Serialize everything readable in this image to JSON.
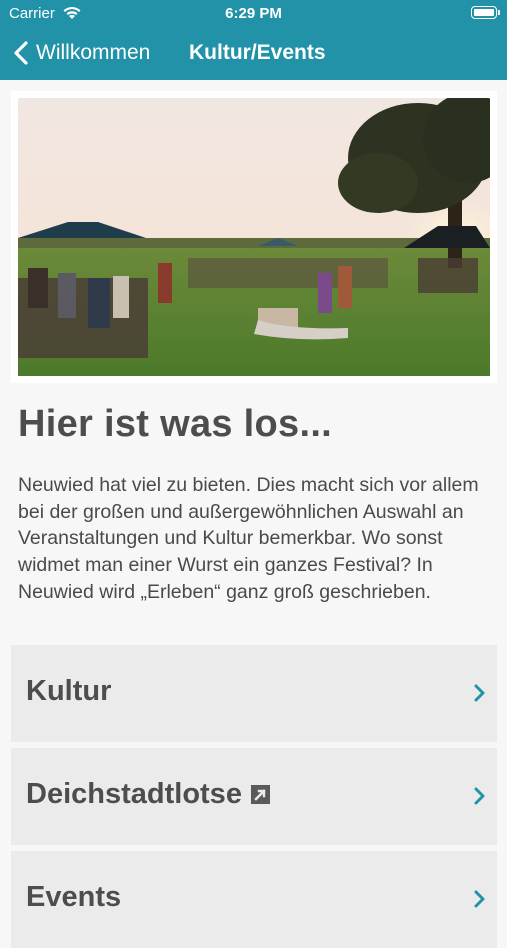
{
  "status_bar": {
    "carrier": "Carrier",
    "time": "6:29 PM"
  },
  "nav": {
    "back_label": "Willkommen",
    "title": "Kultur/Events"
  },
  "hero": {
    "alt": "Festival"
  },
  "content": {
    "headline": "Hier ist was los...",
    "intro": "Neuwied hat viel zu bieten. Dies macht sich vor allem bei der großen und außergewöhnlichen Auswahl an Veranstaltungen und Kultur bemerkbar. Wo sonst widmet man einer Wurst ein ganzes Festival? In Neuwied wird „Erleben“ ganz groß geschrieben."
  },
  "menu": [
    {
      "label": "Kultur",
      "external": false
    },
    {
      "label": "Deichstadtlotse",
      "external": true
    },
    {
      "label": "Events",
      "external": false
    }
  ],
  "colors": {
    "accent": "#2192a8",
    "card_bg": "#ebebeb",
    "page_bg": "#f7f7f7",
    "text": "#4d4d4d"
  },
  "icons": {
    "back": "chevron-left-icon",
    "row": "chevron-right-icon",
    "external": "external-link-icon"
  }
}
